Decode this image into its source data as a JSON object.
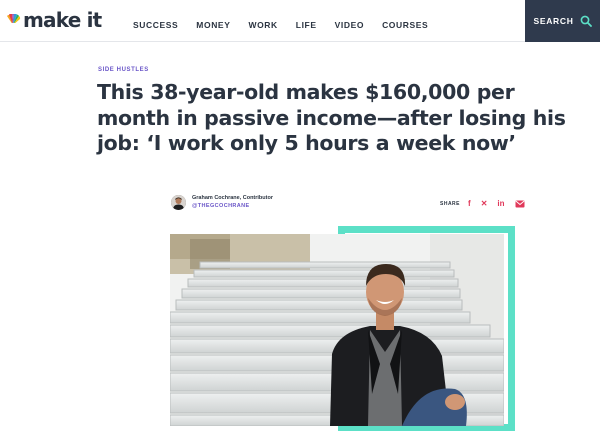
{
  "header": {
    "brand": "make it",
    "nav": [
      "SUCCESS",
      "MONEY",
      "WORK",
      "LIFE",
      "VIDEO",
      "COURSES"
    ],
    "search_label": "SEARCH"
  },
  "article": {
    "kicker": "SIDE HUSTLES",
    "headline": "This 38-year-old makes $160,000 per month in passive income—after losing his job: ‘I work only 5 hours a week now’",
    "author": "Graham Cochrane, Contributor",
    "handle": "@THEGCOCHRANE",
    "share_label": "SHARE"
  },
  "colors": {
    "accent_purple": "#6a56c8",
    "teal": "#5ce0c7",
    "share_pink": "#e0395a",
    "header_dark": "#2f3a4d"
  }
}
